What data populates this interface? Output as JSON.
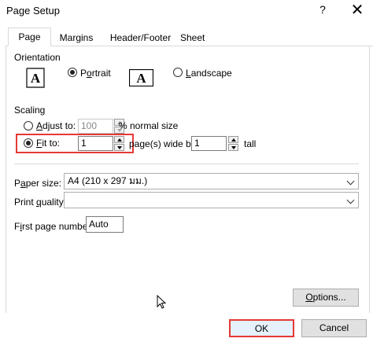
{
  "dialog": {
    "title": "Page Setup",
    "help_label": "?",
    "close_label": "✕"
  },
  "tabs": [
    {
      "label": "Page",
      "active": true
    },
    {
      "label": "Margins",
      "active": false
    },
    {
      "label": "Header/Footer",
      "active": false
    },
    {
      "label": "Sheet",
      "active": false
    }
  ],
  "orientation": {
    "heading": "Orientation",
    "icon_letter": "A",
    "portrait_label": "Portrait",
    "landscape_label": "Landscape",
    "selected": "portrait"
  },
  "scaling": {
    "heading": "Scaling",
    "adjust_label": "Adjust to:",
    "adjust_value": "100",
    "adjust_suffix": "% normal size",
    "fit_label": "Fit to:",
    "fit_wide_value": "1",
    "fit_wide_suffix": "page(s) wide by",
    "fit_tall_value": "1",
    "fit_tall_suffix": "tall",
    "selected": "fit",
    "highlight_color": "#e53935"
  },
  "paper": {
    "paper_size_label": "Paper size:",
    "paper_size_value": "A4 (210 x 297 มม.)",
    "print_quality_label": "Print quality:",
    "print_quality_value": "",
    "first_page_label": "First page number:",
    "first_page_value": "Auto"
  },
  "buttons": {
    "options_label": "Options...",
    "ok_label": "OK",
    "cancel_label": "Cancel"
  }
}
